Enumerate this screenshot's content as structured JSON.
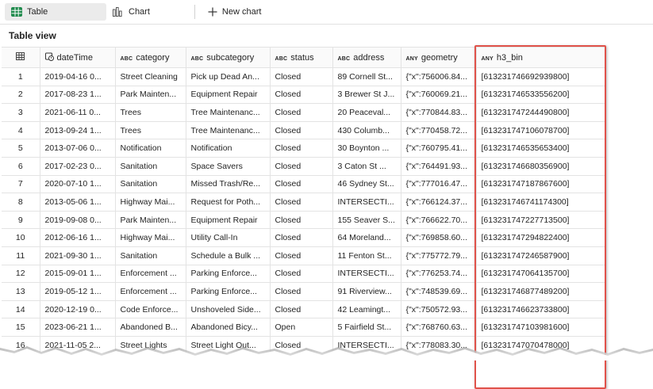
{
  "toolbar": {
    "table_label": "Table",
    "chart_label": "Chart",
    "new_chart_label": "New chart"
  },
  "section_title": "Table view",
  "columns": [
    {
      "type": "",
      "label": ""
    },
    {
      "type": "clock",
      "label": "dateTime"
    },
    {
      "type": "ABC",
      "label": "category"
    },
    {
      "type": "ABC",
      "label": "subcategory"
    },
    {
      "type": "ABC",
      "label": "status"
    },
    {
      "type": "ABC",
      "label": "address"
    },
    {
      "type": "ANY",
      "label": "geometry"
    },
    {
      "type": "ANY",
      "label": "h3_bin"
    }
  ],
  "rows": [
    [
      "1",
      "2019-04-16 0...",
      "Street Cleaning",
      "Pick up Dead An...",
      "Closed",
      "89 Cornell St...",
      "{\"x\":756006.84...",
      "[613231746692939800]"
    ],
    [
      "2",
      "2017-08-23 1...",
      "Park Mainten...",
      "Equipment Repair",
      "Closed",
      "3 Brewer St J...",
      "{\"x\":760069.21...",
      "[613231746533556200]"
    ],
    [
      "3",
      "2021-06-11 0...",
      "Trees",
      "Tree Maintenanc...",
      "Closed",
      "20 Peaceval...",
      "{\"x\":770844.83...",
      "[613231747244490800]"
    ],
    [
      "4",
      "2013-09-24 1...",
      "Trees",
      "Tree Maintenanc...",
      "Closed",
      "430 Columb...",
      "{\"x\":770458.72...",
      "[613231747106078700]"
    ],
    [
      "5",
      "2013-07-06 0...",
      "Notification",
      "Notification",
      "Closed",
      "30 Boynton ...",
      "{\"x\":760795.41...",
      "[613231746535653400]"
    ],
    [
      "6",
      "2017-02-23 0...",
      "Sanitation",
      "Space Savers",
      "Closed",
      "3 Caton St ...",
      "{\"x\":764491.93...",
      "[613231746680356900]"
    ],
    [
      "7",
      "2020-07-10 1...",
      "Sanitation",
      "Missed Trash/Re...",
      "Closed",
      "46 Sydney St...",
      "{\"x\":777016.47...",
      "[613231747187867600]"
    ],
    [
      "8",
      "2013-05-06 1...",
      "Highway Mai...",
      "Request for Poth...",
      "Closed",
      "INTERSECTI...",
      "{\"x\":766124.37...",
      "[613231746741174300]"
    ],
    [
      "9",
      "2019-09-08 0...",
      "Park Mainten...",
      "Equipment Repair",
      "Closed",
      "155 Seaver S...",
      "{\"x\":766622.70...",
      "[613231747227713500]"
    ],
    [
      "10",
      "2012-06-16 1...",
      "Highway Mai...",
      "Utility Call-In",
      "Closed",
      "64 Moreland...",
      "{\"x\":769858.60...",
      "[613231747294822400]"
    ],
    [
      "11",
      "2021-09-30 1...",
      "Sanitation",
      "Schedule a Bulk ...",
      "Closed",
      "11 Fenton St...",
      "{\"x\":775772.79...",
      "[613231747246587900]"
    ],
    [
      "12",
      "2015-09-01 1...",
      "Enforcement ...",
      "Parking Enforce...",
      "Closed",
      "INTERSECTI...",
      "{\"x\":776253.74...",
      "[613231747064135700]"
    ],
    [
      "13",
      "2019-05-12 1...",
      "Enforcement ...",
      "Parking Enforce...",
      "Closed",
      "91 Riverview...",
      "{\"x\":748539.69...",
      "[613231746877489200]"
    ],
    [
      "14",
      "2020-12-19 0...",
      "Code Enforce...",
      "Unshoveled Side...",
      "Closed",
      "42 Leamingt...",
      "{\"x\":750572.93...",
      "[613231746623733800]"
    ],
    [
      "15",
      "2023-06-21 1...",
      "Abandoned B...",
      "Abandoned Bicy...",
      "Open",
      "5 Fairfield St...",
      "{\"x\":768760.63...",
      "[613231747103981600]"
    ],
    [
      "16",
      "2021-11-05 2...",
      "Street Lights",
      "Street Light Out...",
      "Closed",
      "INTERSECTI...",
      "{\"x\":778083.30...",
      "[613231747070478000]"
    ]
  ]
}
